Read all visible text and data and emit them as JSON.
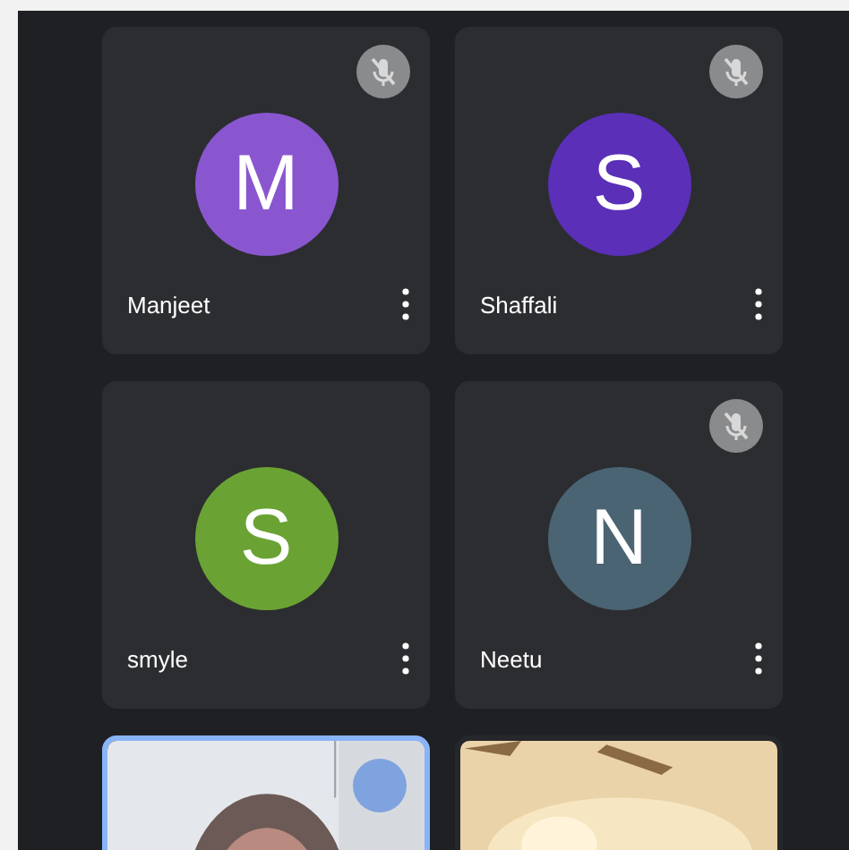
{
  "tiles": [
    {
      "kind": "avatar",
      "name": "Manjeet",
      "initial": "M",
      "color": "#8a56d0",
      "muted": true
    },
    {
      "kind": "avatar",
      "name": "Shaffali",
      "initial": "S",
      "color": "#5b2fb8",
      "muted": true
    },
    {
      "kind": "avatar",
      "name": "smyle",
      "initial": "S",
      "color": "#6aa334",
      "muted": false
    },
    {
      "kind": "avatar",
      "name": "Neetu",
      "initial": "N",
      "color": "#4a6473",
      "muted": true
    },
    {
      "kind": "video",
      "speaking": true
    },
    {
      "kind": "video",
      "speaking": false
    }
  ]
}
